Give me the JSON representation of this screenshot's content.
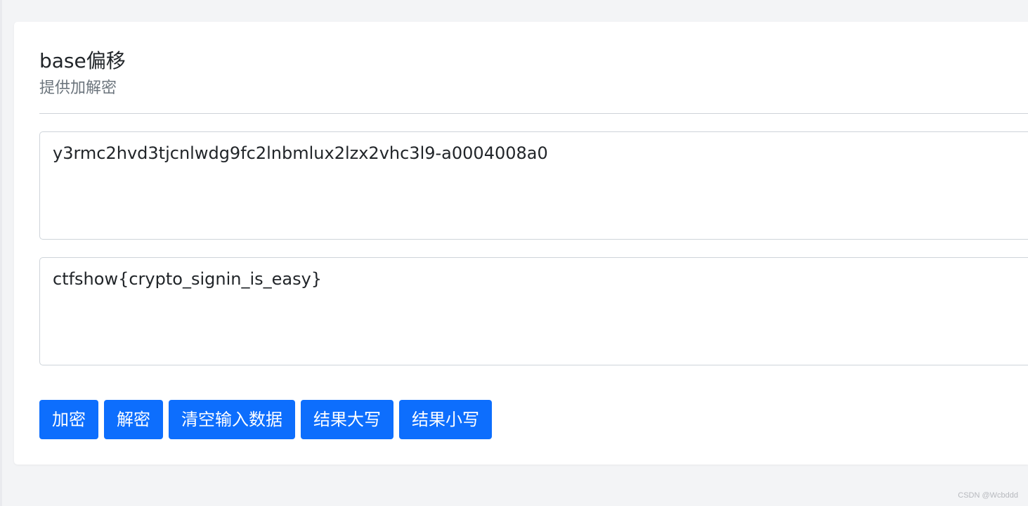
{
  "panel": {
    "title": "base偏移",
    "subtitle": "提供加解密"
  },
  "fields": {
    "input_value": "y3rmc2hvd3tjcnlwdg9fc2lnbmlux2lzx2vhc3l9-a0004008a0",
    "output_value": "ctfshow{crypto_signin_is_easy}"
  },
  "buttons": {
    "encrypt_label": "加密",
    "decrypt_label": "解密",
    "clear_label": "清空输入数据",
    "upper_label": "结果大写",
    "lower_label": "结果小写"
  },
  "watermark": "CSDN @Wcbddd",
  "colors": {
    "accent": "#0d6efd",
    "background": "#f3f4f6"
  }
}
